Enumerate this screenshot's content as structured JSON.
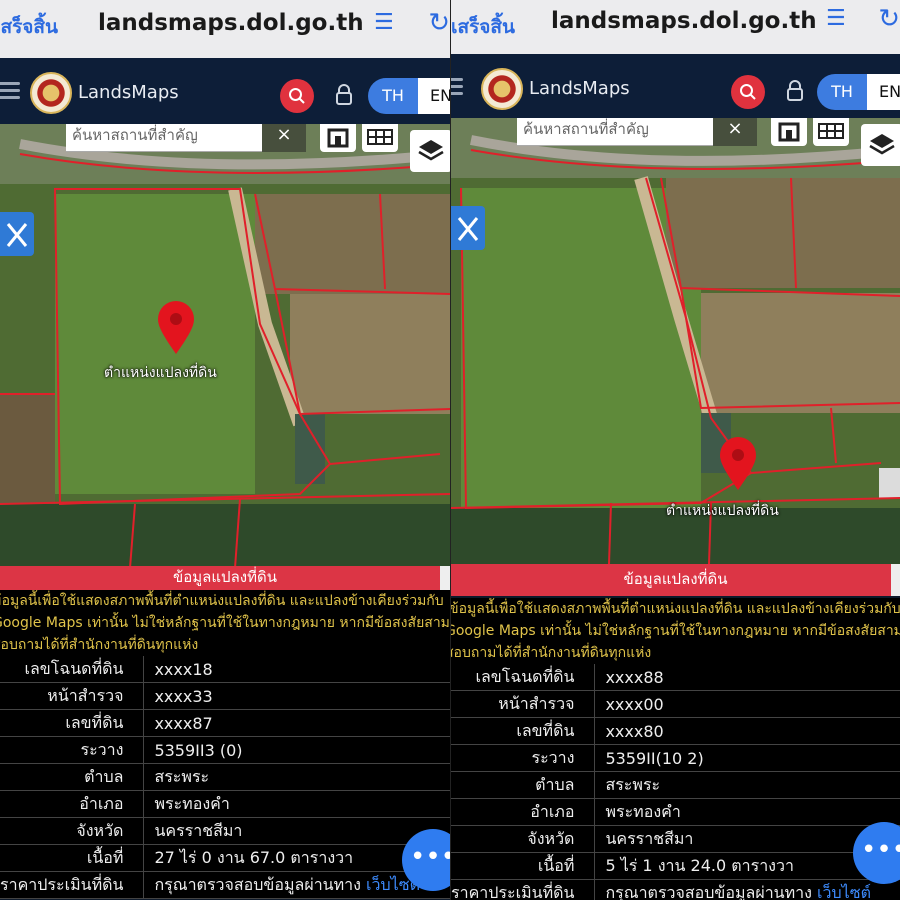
{
  "browser": {
    "done_label": "เสร็จสิ้น",
    "url": "landsmaps.dol.go.th"
  },
  "header": {
    "brand": "LandsMaps",
    "lang_th": "TH",
    "lang_en": "EN"
  },
  "map": {
    "search_placeholder": "ค้นหาสถานที่สำคัญ",
    "clear": "×",
    "pin_label": "ตำแหน่งแปลงที่ดิน"
  },
  "info_title": "ข้อมูลแปลงที่ดิน",
  "notice": [
    "ข้อมูลนี้เพื่อใช้แสดงสภาพพื้นที่ตำแหน่งแปลงที่ดิน และแปลงข้างเคียงร่วมกับ",
    "Google Maps เท่านั้น ไม่ใช่หลักฐานที่ใช้ในทางกฎหมาย หากมีข้อสงสัยสามารถ",
    "สอบถามได้ที่สำนักงานที่ดินทุกแห่ง"
  ],
  "fab_icon": "•••",
  "left": {
    "rows": [
      {
        "k": "เลขโฉนดที่ดิน",
        "v": "xxxx18"
      },
      {
        "k": "หน้าสำรวจ",
        "v": "xxxx33"
      },
      {
        "k": "เลขที่ดิน",
        "v": "xxxx87"
      },
      {
        "k": "ระวาง",
        "v": "5359II3                (0)"
      },
      {
        "k": "ตำบล",
        "v": "สระพระ"
      },
      {
        "k": "อำเภอ",
        "v": "พระทองคำ"
      },
      {
        "k": "จังหวัด",
        "v": "นครราชสีมา"
      },
      {
        "k": "เนื้อที่",
        "v": "27 ไร่ 0 งาน 67.0 ตารางวา"
      },
      {
        "k": "ราคาประเมินที่ดิน",
        "v": "กรุณาตรวจสอบข้อมูลผ่านทาง ",
        "link": "เว็บไซต์"
      }
    ]
  },
  "right": {
    "rows": [
      {
        "k": "เลขโฉนดที่ดิน",
        "v": "xxxx88"
      },
      {
        "k": "หน้าสำรวจ",
        "v": "xxxx00"
      },
      {
        "k": "เลขที่ดิน",
        "v": "xxxx80"
      },
      {
        "k": "ระวาง",
        "v": "5359II(10        2)"
      },
      {
        "k": "ตำบล",
        "v": "สระพระ"
      },
      {
        "k": "อำเภอ",
        "v": "พระทองคำ"
      },
      {
        "k": "จังหวัด",
        "v": "นครราชสีมา"
      },
      {
        "k": "เนื้อที่",
        "v": "5 ไร่ 1 งาน 24.0 ตารางวา"
      },
      {
        "k": "ราคาประเมินที่ดิน",
        "v": "กรุณาตรวจสอบข้อมูลผ่านทาง ",
        "link": "เว็บไซต์"
      }
    ]
  },
  "colors": {
    "accent": "#2d6be0",
    "header": "#0d1e38",
    "parcel_line": "#e0202a",
    "notice_text": "#e0c34a"
  }
}
